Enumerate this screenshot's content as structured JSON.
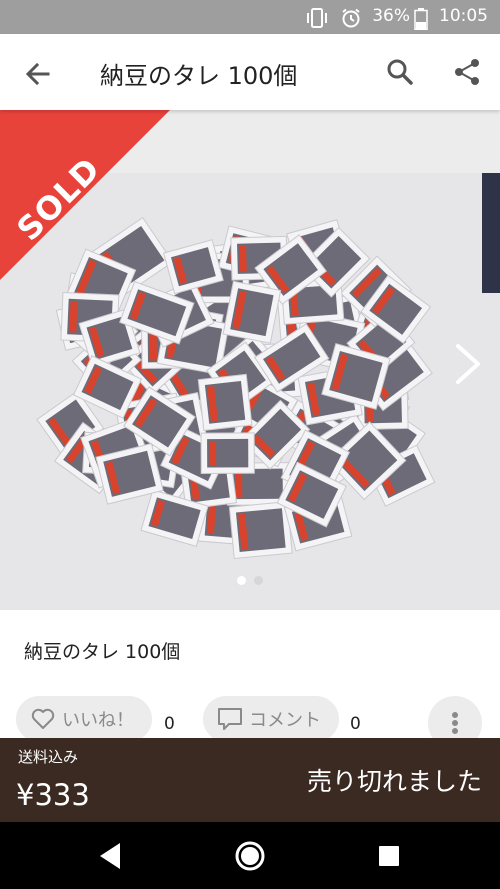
{
  "status_bar": {
    "battery": "36%",
    "time": "10:05",
    "icons": [
      "vibrate-icon",
      "alarm-icon",
      "battery-icon"
    ]
  },
  "app_bar": {
    "title": "納豆のタレ 100個",
    "icons": [
      "back-arrow-icon",
      "search-icon",
      "share-icon"
    ]
  },
  "carousel": {
    "badge": "SOLD",
    "badge_color": "#e8433b",
    "page_count": 2,
    "current_page": 1
  },
  "item": {
    "name": "納豆のタレ 100個",
    "like_label": "いいね！",
    "like_count": "0",
    "comment_label": "コメント",
    "comment_count": "0"
  },
  "price_bar": {
    "shipping": "送料込み",
    "price": "¥333",
    "status": "売り切れました",
    "background": "#3a2a22"
  }
}
